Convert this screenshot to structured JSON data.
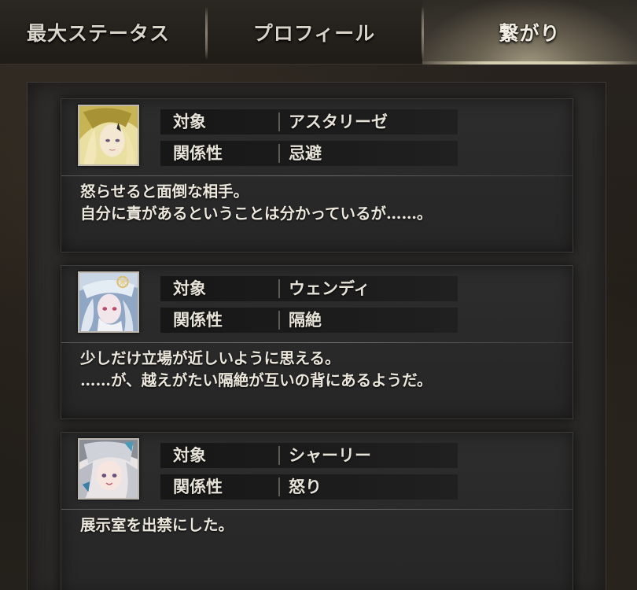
{
  "tabs": [
    {
      "label": "最大ステータス",
      "active": false
    },
    {
      "label": "プロフィール",
      "active": false
    },
    {
      "label": "繋がり",
      "active": true
    }
  ],
  "field_labels": {
    "target": "対象",
    "relation": "関係性"
  },
  "relations": [
    {
      "target": "アスタリーゼ",
      "relation": "忌避",
      "description": [
        "怒らせると面倒な相手。",
        "自分に責があるということは分かっているが……。"
      ]
    },
    {
      "target": "ウェンディ",
      "relation": "隔絶",
      "description": [
        "少しだけ立場が近しいように思える。",
        "……が、越えがたい隔絶が互いの背にあるようだ。"
      ]
    },
    {
      "target": "シャーリー",
      "relation": "怒り",
      "description": [
        "展示室を出禁にした。"
      ]
    }
  ],
  "colors": {
    "panel_bg": "#2f2d2b",
    "card_bg": "#2a2a2a",
    "text": "#e8e2d6",
    "active_tab_glow": "#c8bea0"
  }
}
